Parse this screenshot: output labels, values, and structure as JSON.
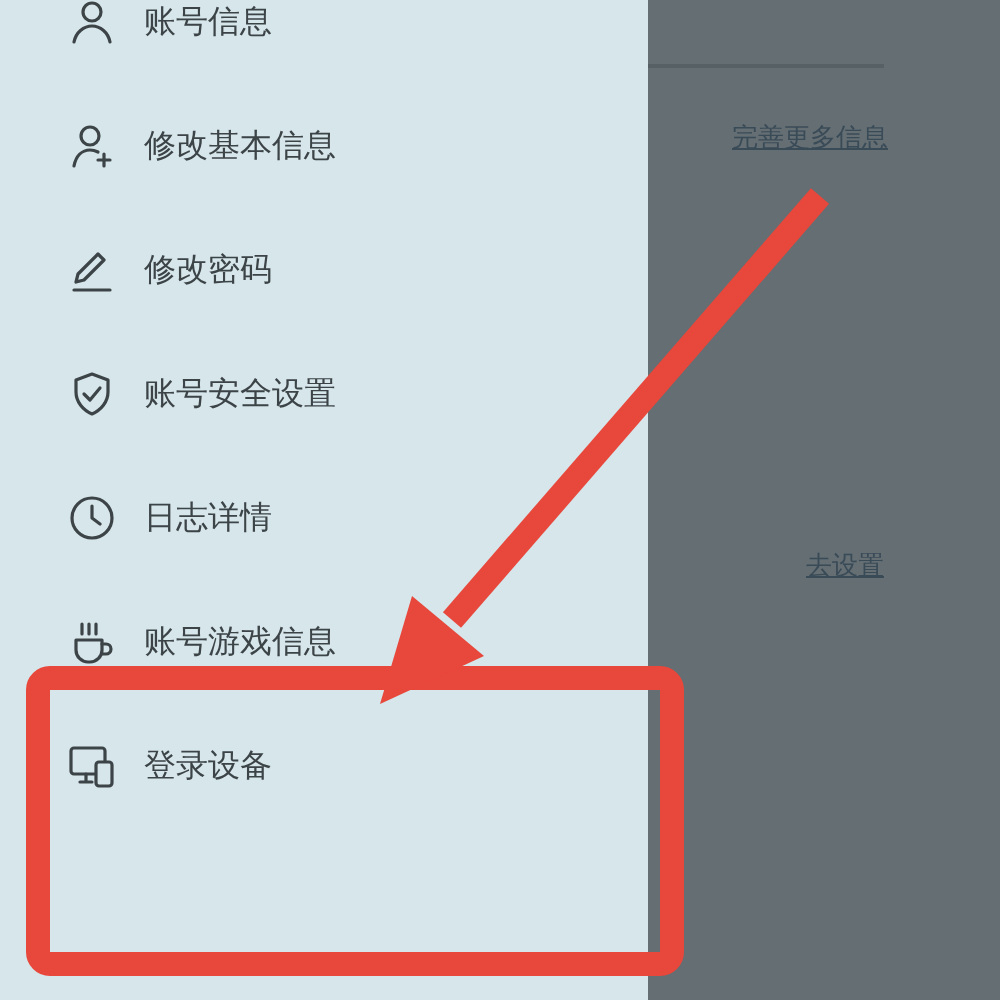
{
  "menu": {
    "items": [
      {
        "label": "账号信息"
      },
      {
        "label": "修改基本信息"
      },
      {
        "label": "修改密码"
      },
      {
        "label": "账号安全设置"
      },
      {
        "label": "日志详情"
      },
      {
        "label": "账号游戏信息"
      },
      {
        "label": "登录设备"
      }
    ]
  },
  "background_page": {
    "links": [
      "完善更多信息",
      "去设置"
    ]
  }
}
